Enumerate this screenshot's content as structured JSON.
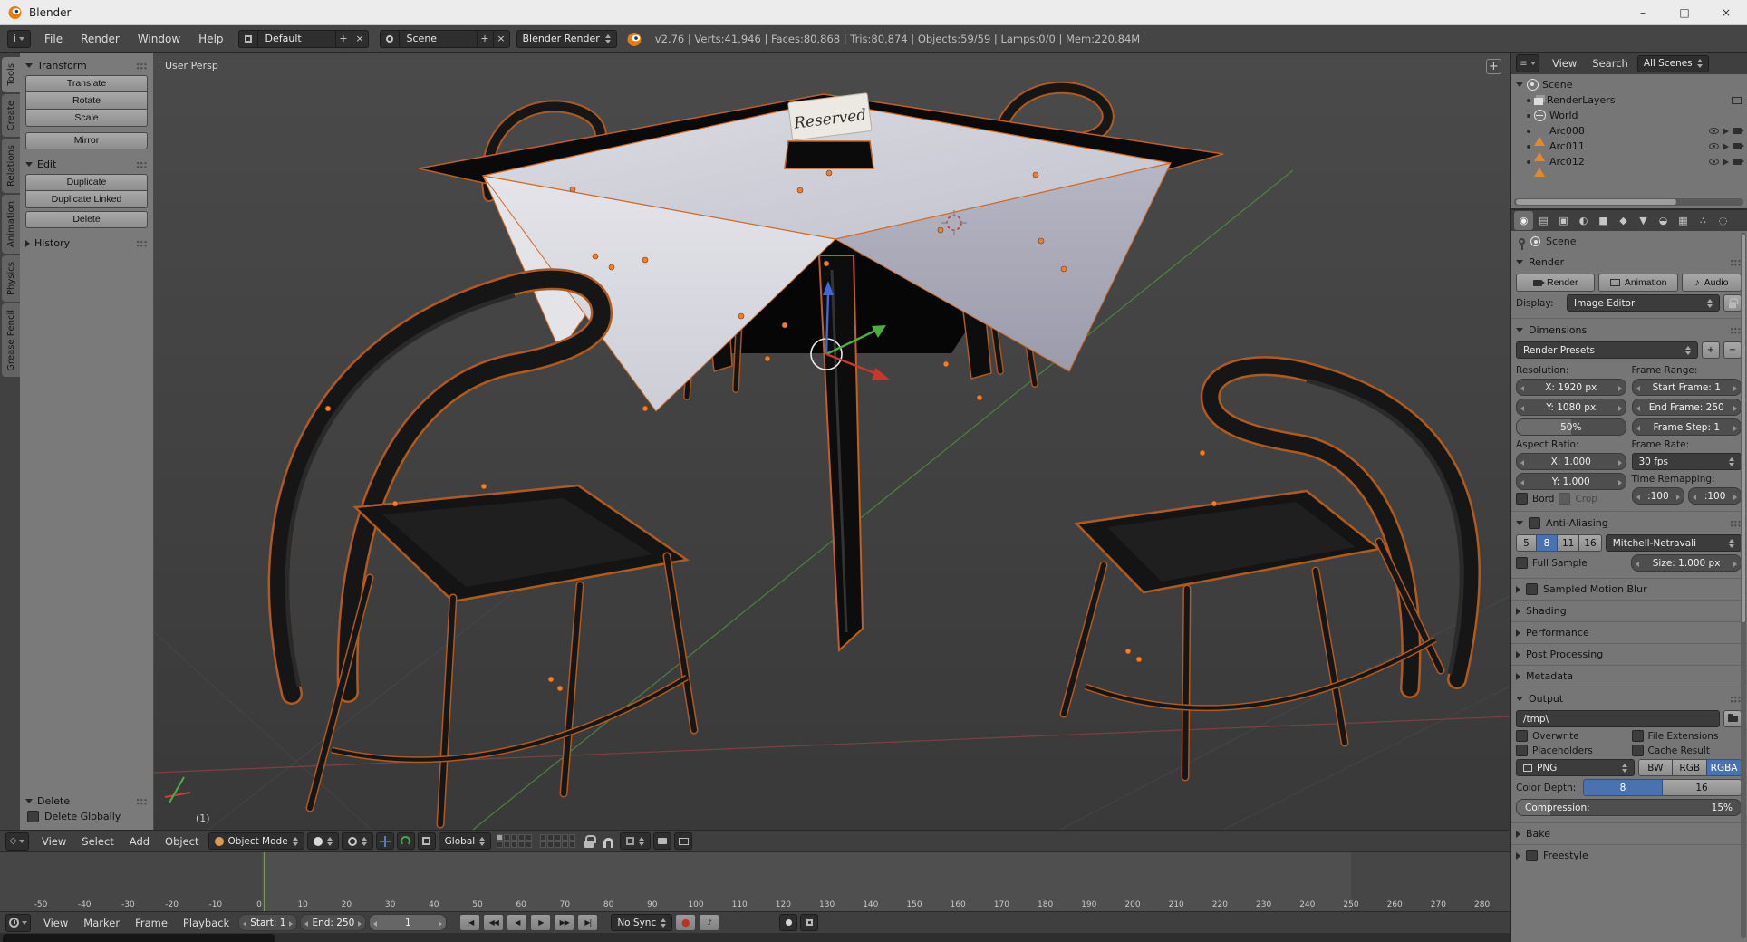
{
  "titlebar": {
    "title": "Blender"
  },
  "icons": {
    "minimize": "–",
    "maximize": "□",
    "close": "×",
    "close_small": "×",
    "plus": "+",
    "minus": "−",
    "check": "✓",
    "note": "♪",
    "jump_start": "|◀",
    "key_prev": "◀◀",
    "play_rev": "◀",
    "play": "▶",
    "key_next": "▶▶",
    "jump_end": "▶|",
    "record": "●",
    "camera_glyph": "◉",
    "clapper_glyph": "▸"
  },
  "menubar": {
    "menus": [
      "File",
      "Render",
      "Window",
      "Help"
    ],
    "layout": "Default",
    "scene": "Scene",
    "engine": "Blender Render",
    "stats": "v2.76 | Verts:41,946 | Faces:80,868 | Tris:80,874 | Objects:59/59 | Lamps:0/0 | Mem:220.84M"
  },
  "toolshelf": {
    "tabs": [
      "Tools",
      "Create",
      "Relations",
      "Animation",
      "Physics",
      "Grease Pencil"
    ],
    "transform": {
      "title": "Transform",
      "translate": "Translate",
      "rotate": "Rotate",
      "scale": "Scale",
      "mirror": "Mirror"
    },
    "edit": {
      "title": "Edit",
      "duplicate": "Duplicate",
      "duplicate_linked": "Duplicate Linked",
      "delete": "Delete"
    },
    "history": {
      "title": "History"
    },
    "operator": {
      "title": "Delete",
      "option": "Delete Globally"
    }
  },
  "viewport": {
    "view_label": "User Persp",
    "layer_indicator": "(1)",
    "sign": "Reserved",
    "header": {
      "menus": [
        "View",
        "Select",
        "Add",
        "Object"
      ],
      "mode": "Object Mode",
      "orientation": "Global"
    }
  },
  "outliner": {
    "menus": [
      "View",
      "Search"
    ],
    "display_mode": "All Scenes",
    "root": "Scene",
    "items": [
      {
        "label": "RenderLayers"
      },
      {
        "label": "World"
      },
      {
        "label": "Arc008"
      },
      {
        "label": "Arc011"
      },
      {
        "label": "Arc012"
      }
    ]
  },
  "properties": {
    "context": "Scene",
    "tabs": [
      {
        "name": "render",
        "glyph": "◉",
        "active": true
      },
      {
        "name": "render-layers",
        "glyph": "▤",
        "active": false
      },
      {
        "name": "scene",
        "glyph": "▣",
        "active": false
      },
      {
        "name": "world",
        "glyph": "◐",
        "active": false
      },
      {
        "name": "object",
        "glyph": "■",
        "active": false
      },
      {
        "name": "modifiers",
        "glyph": "◆",
        "active": false
      },
      {
        "name": "data",
        "glyph": "▼",
        "active": false
      },
      {
        "name": "material",
        "glyph": "◒",
        "active": false
      },
      {
        "name": "texture",
        "glyph": "▦",
        "active": false
      },
      {
        "name": "particles",
        "glyph": "∴",
        "active": false
      },
      {
        "name": "physics",
        "glyph": "◌",
        "active": false
      }
    ],
    "render": {
      "title": "Render",
      "render_btn": "Render",
      "animation_btn": "Animation",
      "audio_btn": "Audio",
      "display_label": "Display:",
      "display_value": "Image Editor"
    },
    "dimensions": {
      "title": "Dimensions",
      "presets": "Render Presets",
      "resolution_label": "Resolution:",
      "res_x": "X: 1920 px",
      "res_y": "Y: 1080 px",
      "res_percent": "50%",
      "frame_range_label": "Frame Range:",
      "start_frame": "Start Frame: 1",
      "end_frame": "End Frame: 250",
      "frame_step": "Frame Step: 1",
      "aspect_label": "Aspect Ratio:",
      "aspect_x": "X: 1.000",
      "aspect_y": "Y: 1.000",
      "frame_rate_label": "Frame Rate:",
      "frame_rate": "30 fps",
      "time_remap_label": "Time Remapping:",
      "remap_a": ":100",
      "remap_b": ":100",
      "border": "Bord",
      "crop": "Crop"
    },
    "antialiasing": {
      "title": "Anti-Aliasing",
      "samples": [
        "5",
        "8",
        "11",
        "16"
      ],
      "active_sample": "8",
      "filter": "Mitchell-Netravali",
      "full_sample": "Full Sample",
      "size": "Size: 1.000 px"
    },
    "collapsed": [
      {
        "title": "Sampled Motion Blur"
      },
      {
        "title": "Shading"
      },
      {
        "title": "Performance"
      },
      {
        "title": "Post Processing"
      },
      {
        "title": "Metadata"
      }
    ],
    "output": {
      "title": "Output",
      "path": "/tmp\\",
      "overwrite": "Overwrite",
      "file_extensions": "File Extensions",
      "placeholders": "Placeholders",
      "cache_result": "Cache Result",
      "format": "PNG",
      "modes": [
        "BW",
        "RGB",
        "RGBA"
      ],
      "active_mode": "RGBA",
      "depth_label": "Color Depth:",
      "depths": [
        "8",
        "16"
      ],
      "active_depth": "8",
      "compression_label": "Compression:",
      "compression_value": "15%",
      "compression_pct": 15
    },
    "bake": {
      "title": "Bake"
    },
    "freestyle": {
      "title": "Freestyle"
    }
  },
  "timeline": {
    "ruler": [
      -50,
      -40,
      -30,
      -20,
      -10,
      0,
      10,
      20,
      30,
      40,
      50,
      60,
      70,
      80,
      90,
      100,
      110,
      120,
      130,
      140,
      150,
      160,
      170,
      180,
      190,
      200,
      210,
      220,
      230,
      240,
      250,
      260,
      270,
      280
    ],
    "current_frame": 1,
    "header": {
      "menus": [
        "View",
        "Marker",
        "Frame",
        "Playback"
      ],
      "start": "Start: 1",
      "end": "End: 250",
      "frame": "1",
      "sync": "No Sync"
    }
  },
  "colors": {
    "accent_orange": "#ee7f2d",
    "select_blue": "#4a72b0",
    "frame_green": "#6aa33f",
    "mesh_icon_orange": "#e2882f"
  }
}
